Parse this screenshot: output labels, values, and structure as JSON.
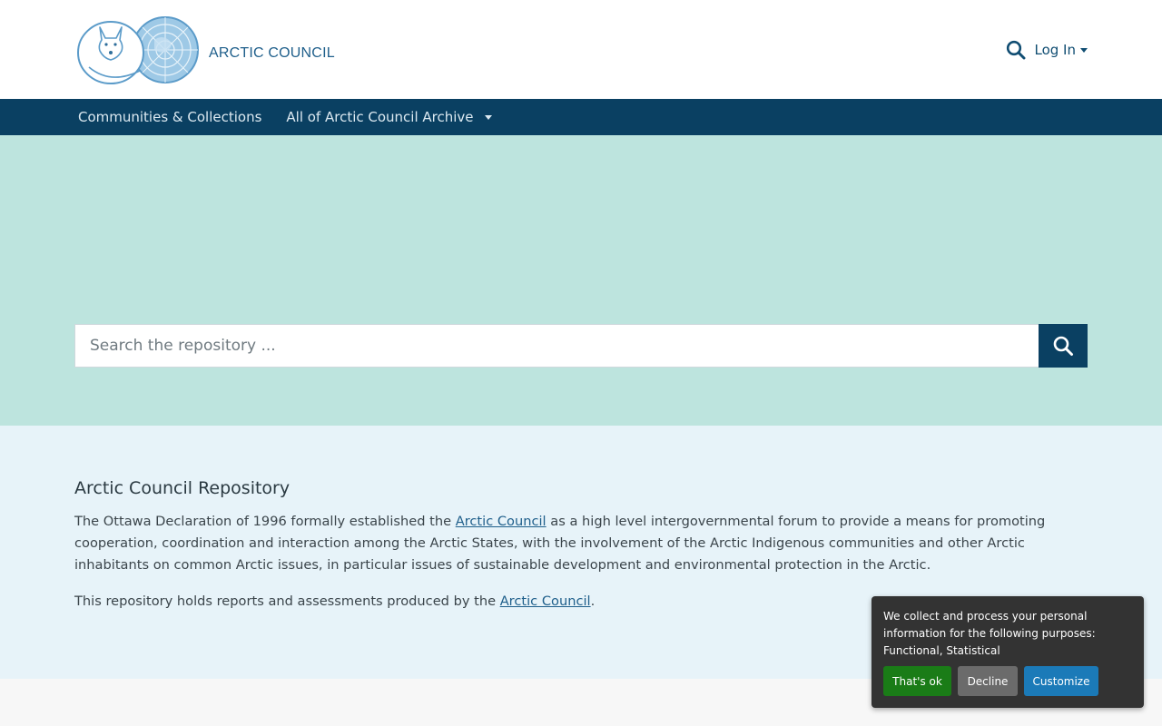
{
  "header": {
    "logo_text": "ARCTIC COUNCIL",
    "login_label": "Log In",
    "search_icon": "search-icon"
  },
  "nav": {
    "items": [
      {
        "label": "Communities & Collections"
      },
      {
        "label": "All of Arctic Council Archive"
      }
    ]
  },
  "hero": {
    "search_placeholder": "Search the repository ...",
    "search_button_icon": "search-icon"
  },
  "intro": {
    "title": "Arctic Council Repository",
    "p1_before": "The Ottawa Declaration of 1996 formally established the ",
    "p1_link": "Arctic Council",
    "p1_after": " as a high level intergovernmental forum to provide a means for promoting cooperation, coordination and interaction among the Arctic States, with the involvement of the Arctic Indigenous communities and other Arctic inhabitants on common Arctic issues, in particular issues of sustainable development and environmental protection in the Arctic.",
    "p2_before": "This repository holds reports and assessments produced by the ",
    "p2_link": "Arctic Council",
    "p2_after": "."
  },
  "consent": {
    "text": "We collect and process your personal information for the following purposes: Functional, Statistical",
    "ok_label": "That's ok",
    "decline_label": "Decline",
    "customize_label": "Customize"
  },
  "colors": {
    "brand": "#0a4062",
    "hero_bg": "#bde4de",
    "intro_bg": "#e7f3f9",
    "link": "#1f5f8b",
    "ok_green": "#1a7c17",
    "customize_blue": "#1b7ab8"
  }
}
